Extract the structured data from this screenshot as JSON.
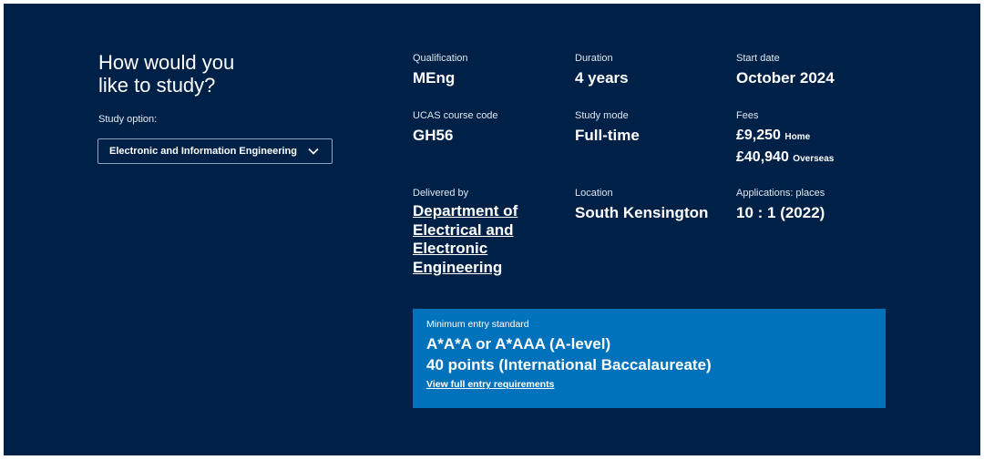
{
  "section": {
    "heading_line1": "How would you",
    "heading_line2": "like to study?",
    "study_option_label": "Study option:",
    "study_option_value": "Electronic and Information Engineering",
    "chevron_icon": "chevron-down-icon"
  },
  "facts": {
    "qualification": {
      "label": "Qualification",
      "value": "MEng"
    },
    "duration": {
      "label": "Duration",
      "value": "4 years"
    },
    "start_date": {
      "label": "Start date",
      "value": "October 2024"
    },
    "ucas_code": {
      "label": "UCAS course code",
      "value": "GH56"
    },
    "study_mode": {
      "label": "Study mode",
      "value": "Full-time"
    },
    "fees": {
      "label": "Fees",
      "home_amount": "£9,250",
      "home_suffix": "Home",
      "overseas_amount": "£40,940",
      "overseas_suffix": "Overseas"
    },
    "delivered_by": {
      "label": "Delivered by",
      "value": "Department of Electrical and Electronic Engineering"
    },
    "location": {
      "label": "Location",
      "value": "South Kensington"
    },
    "applications": {
      "label": "Applications: places",
      "value": "10 : 1 (2022)"
    }
  },
  "entry": {
    "label": "Minimum entry standard",
    "line1": "A*A*A or A*AAA (A-level)",
    "line2": "40 points (International Baccalaureate)",
    "link": "View full entry requirements"
  },
  "colors": {
    "panel_bg": "#002147",
    "entry_bg": "#0072bc",
    "text": "#ffffff"
  }
}
